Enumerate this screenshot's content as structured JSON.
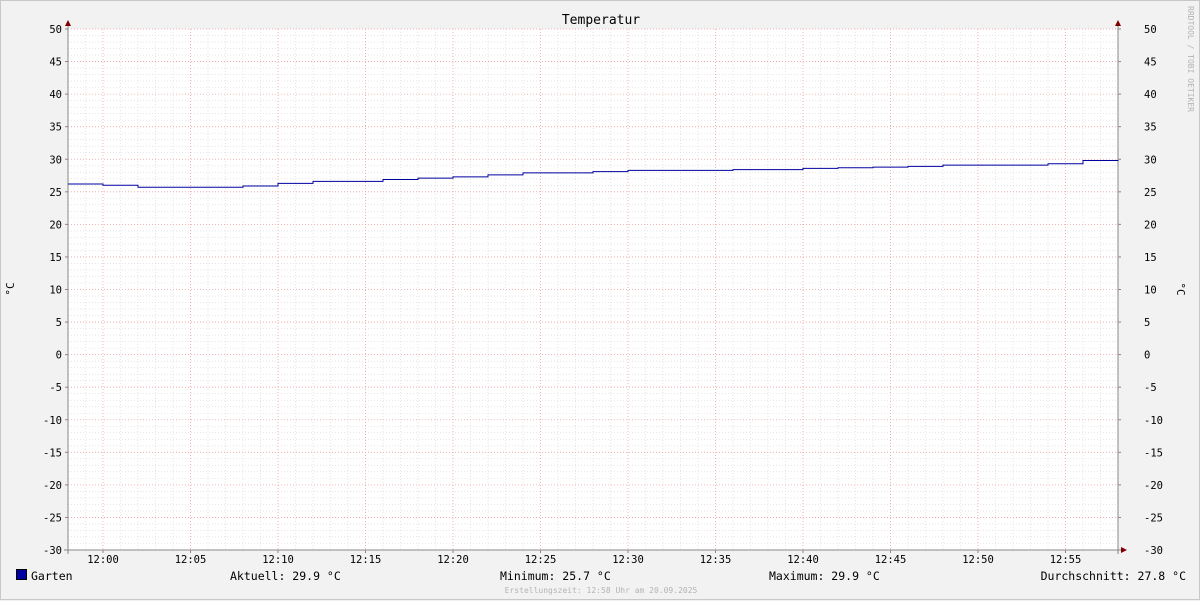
{
  "chart_data": {
    "type": "line",
    "title": "Temperatur",
    "ylabel": "°C",
    "ylabel_right": "°C",
    "ylim": [
      -30,
      50
    ],
    "yticks": [
      50,
      45,
      40,
      35,
      30,
      25,
      20,
      15,
      10,
      5,
      0,
      -5,
      -10,
      -15,
      -20,
      -25,
      -30
    ],
    "xlim": [
      "11:58",
      "12:58"
    ],
    "xticks": [
      "12:00",
      "12:05",
      "12:10",
      "12:15",
      "12:20",
      "12:25",
      "12:30",
      "12:35",
      "12:40",
      "12:45",
      "12:50",
      "12:55"
    ],
    "grid": true,
    "series": [
      {
        "name": "Garten",
        "color": "#0000a0",
        "x": [
          "11:58",
          "12:00",
          "12:02",
          "12:04",
          "12:06",
          "12:08",
          "12:10",
          "12:12",
          "12:14",
          "12:16",
          "12:18",
          "12:20",
          "12:22",
          "12:24",
          "12:26",
          "12:28",
          "12:30",
          "12:32",
          "12:34",
          "12:36",
          "12:38",
          "12:40",
          "12:42",
          "12:44",
          "12:46",
          "12:48",
          "12:50",
          "12:52",
          "12:54",
          "12:56",
          "12:58"
        ],
        "y": [
          26.2,
          26.0,
          25.7,
          25.7,
          25.7,
          25.9,
          26.3,
          26.6,
          26.6,
          26.9,
          27.1,
          27.3,
          27.6,
          27.9,
          27.9,
          28.1,
          28.3,
          28.3,
          28.3,
          28.4,
          28.4,
          28.6,
          28.7,
          28.8,
          28.9,
          29.1,
          29.1,
          29.1,
          29.3,
          29.8,
          29.9
        ]
      }
    ]
  },
  "watermark": "RRDTOOL / TOBI OETIKER",
  "legend": {
    "series_name": "Garten",
    "series_color": "#0000a0",
    "current": "Aktuell: 29.9 °C",
    "minimum": "Minimum: 25.7 °C",
    "maximum": "Maximum: 29.9 °C",
    "average": "Durchschnitt: 27.8 °C"
  },
  "footer": "Erstellungszeit: 12:58 Uhr am 20.09.2025",
  "colors": {
    "major_grid": "#f0a0a0",
    "minor_grid": "#d6d6d6",
    "axis": "#888888",
    "arrow": "#800000"
  }
}
